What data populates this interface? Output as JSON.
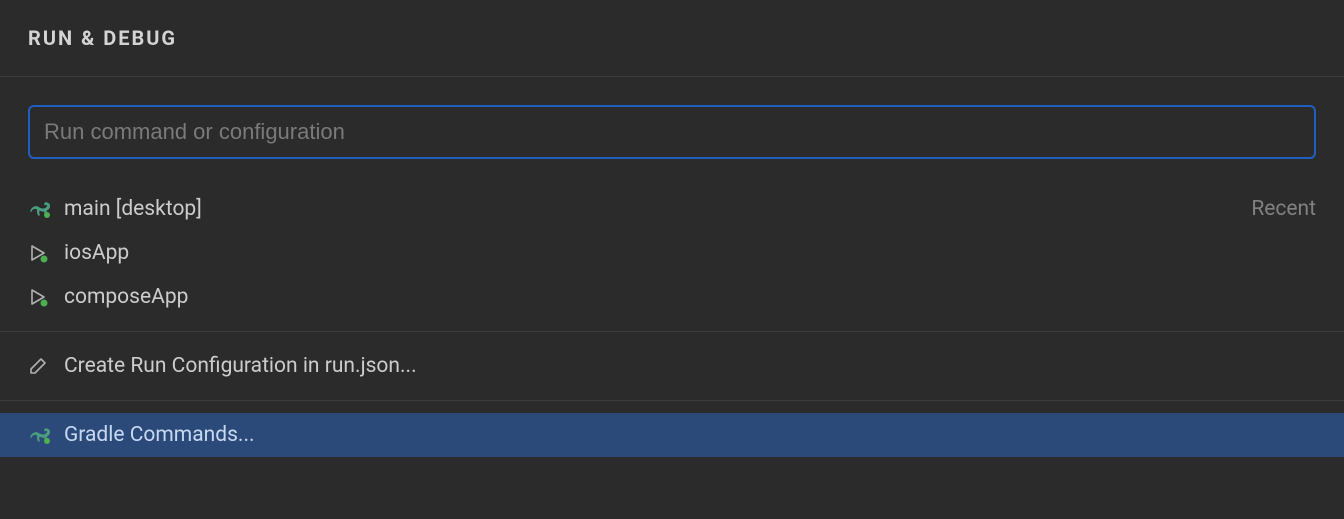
{
  "header": {
    "title": "RUN & DEBUG"
  },
  "search": {
    "placeholder": "Run command or configuration",
    "value": ""
  },
  "recent_label": "Recent",
  "configs": [
    {
      "label": "main [desktop]",
      "icon": "gradle"
    },
    {
      "label": "iosApp",
      "icon": "play"
    },
    {
      "label": "composeApp",
      "icon": "play"
    }
  ],
  "actions": {
    "create_config": "Create Run Configuration in run.json...",
    "gradle_commands": "Gradle Commands..."
  }
}
